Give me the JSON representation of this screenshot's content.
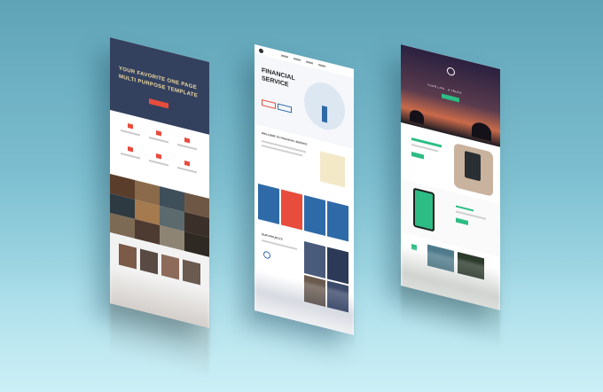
{
  "mockup_left": {
    "hero_title_line1": "YOUR FAVORITE ONE PAGE",
    "hero_title_line2": "MULTI PURPOSE TEMPLATE",
    "colors": {
      "hero": "#33415f",
      "accent": "#e74c3c"
    }
  },
  "mockup_middle": {
    "hero_title_line1": "FINANCIAL",
    "hero_title_line2": "SERVICE",
    "welcome_heading": "WELCOME TO FINANCIAL SERVICE",
    "projects_heading": "OUR PROJECTS",
    "colors": {
      "accent": "#e74c3c",
      "blue": "#2f6aa8"
    }
  },
  "mockup_right": {
    "hero_tagline": "YOUR LIFE · A TRUTH",
    "colors": {
      "green": "#2dbd84",
      "sky": "#3a2d3f"
    }
  }
}
